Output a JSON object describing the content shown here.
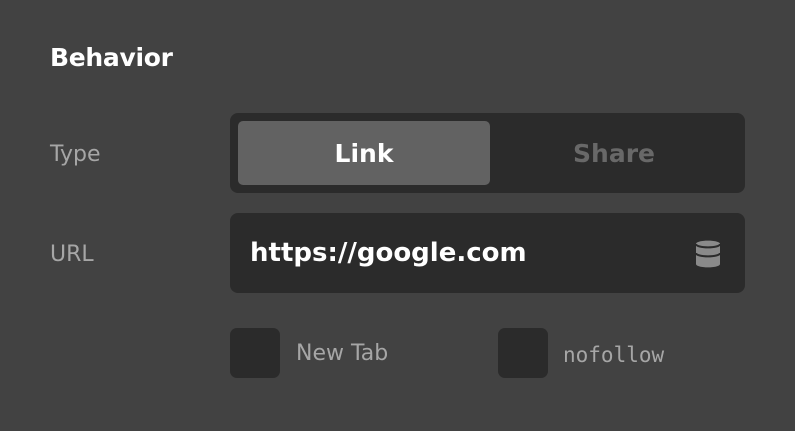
{
  "section": {
    "title": "Behavior"
  },
  "type_row": {
    "label": "Type",
    "options": [
      {
        "label": "Link",
        "selected": true
      },
      {
        "label": "Share",
        "selected": false
      }
    ]
  },
  "url_row": {
    "label": "URL",
    "value": "https://google.com",
    "icon": "database-icon"
  },
  "options": {
    "new_tab": {
      "label": "New Tab",
      "checked": false
    },
    "nofollow": {
      "label": "nofollow",
      "checked": false
    }
  },
  "colors": {
    "background": "#424242",
    "control": "#2b2b2b",
    "selected_segment": "#626262",
    "label": "#a6a6a6",
    "muted": "#686868",
    "text": "#ffffff"
  }
}
